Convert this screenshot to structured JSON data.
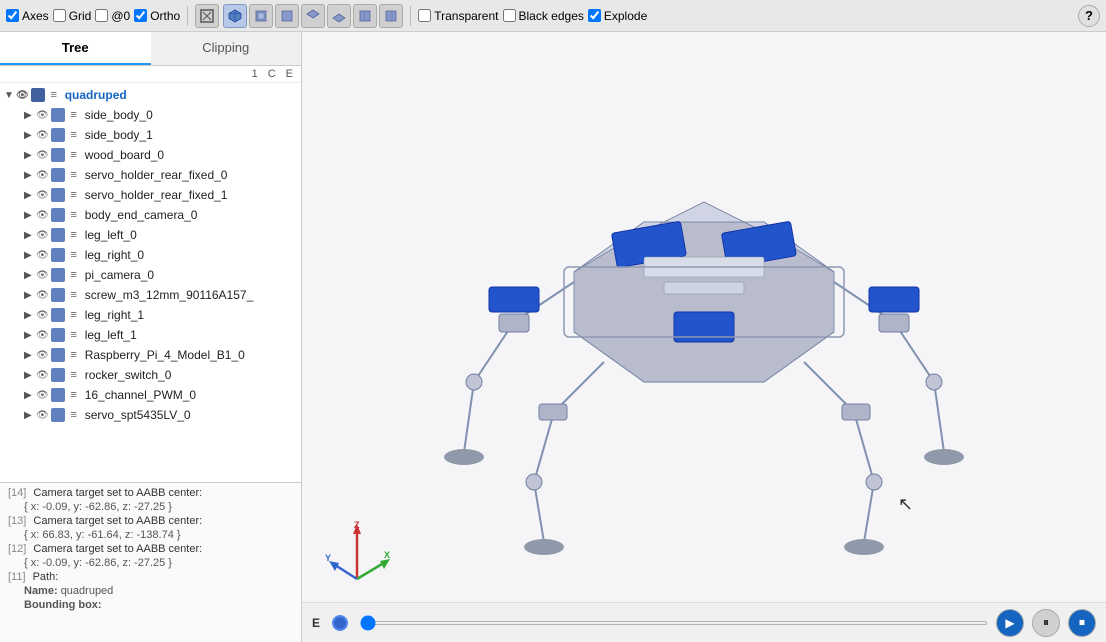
{
  "toolbar": {
    "axes_label": "Axes",
    "grid_label": "Grid",
    "at0_label": "@0",
    "ortho_label": "Ortho",
    "transparent_label": "Transparent",
    "black_edges_label": "Black edges",
    "explode_label": "Explode",
    "axes_checked": true,
    "grid_checked": false,
    "at0_checked": false,
    "ortho_checked": true,
    "transparent_checked": false,
    "black_edges_checked": false,
    "explode_checked": true,
    "help_icon": "?"
  },
  "view_buttons": [
    {
      "id": "fit",
      "label": "⊡",
      "active": false,
      "title": "Fit"
    },
    {
      "id": "iso",
      "label": "◈",
      "active": true,
      "title": "Isometric"
    },
    {
      "id": "front",
      "label": "▣",
      "active": false,
      "title": "Front"
    },
    {
      "id": "back",
      "label": "▣",
      "active": false,
      "title": "Back"
    },
    {
      "id": "top",
      "label": "▣",
      "active": false,
      "title": "Top"
    },
    {
      "id": "bottom",
      "label": "▣",
      "active": false,
      "title": "Bottom"
    },
    {
      "id": "left",
      "label": "▣",
      "active": false,
      "title": "Left"
    },
    {
      "id": "right",
      "label": "▣",
      "active": false,
      "title": "Right"
    }
  ],
  "tabs": [
    {
      "label": "Tree",
      "active": true
    },
    {
      "label": "Clipping",
      "active": false
    }
  ],
  "tree_header": {
    "col1": "1",
    "col2": "C",
    "col3": "E"
  },
  "tree_items": [
    {
      "level": 0,
      "label": "quadruped",
      "is_root": true,
      "has_arrow": true,
      "expanded": true
    },
    {
      "level": 1,
      "label": "side_body_0",
      "is_root": false,
      "has_arrow": true
    },
    {
      "level": 1,
      "label": "side_body_1",
      "is_root": false,
      "has_arrow": true
    },
    {
      "level": 1,
      "label": "wood_board_0",
      "is_root": false,
      "has_arrow": true
    },
    {
      "level": 1,
      "label": "servo_holder_rear_fixed_0",
      "is_root": false,
      "has_arrow": true
    },
    {
      "level": 1,
      "label": "servo_holder_rear_fixed_1",
      "is_root": false,
      "has_arrow": true
    },
    {
      "level": 1,
      "label": "body_end_camera_0",
      "is_root": false,
      "has_arrow": true
    },
    {
      "level": 1,
      "label": "leg_left_0",
      "is_root": false,
      "has_arrow": true
    },
    {
      "level": 1,
      "label": "leg_right_0",
      "is_root": false,
      "has_arrow": true
    },
    {
      "level": 1,
      "label": "pi_camera_0",
      "is_root": false,
      "has_arrow": true
    },
    {
      "level": 1,
      "label": "screw_m3_12mm_90116A157_",
      "is_root": false,
      "has_arrow": true
    },
    {
      "level": 1,
      "label": "leg_right_1",
      "is_root": false,
      "has_arrow": true
    },
    {
      "level": 1,
      "label": "leg_left_1",
      "is_root": false,
      "has_arrow": true
    },
    {
      "level": 1,
      "label": "Raspberry_Pi_4_Model_B1_0",
      "is_root": false,
      "has_arrow": true
    },
    {
      "level": 1,
      "label": "rocker_switch_0",
      "is_root": false,
      "has_arrow": true
    },
    {
      "level": 1,
      "label": "16_channel_PWM_0",
      "is_root": false,
      "has_arrow": true
    },
    {
      "level": 1,
      "label": "servo_spt5435LV_0",
      "is_root": false,
      "has_arrow": true
    }
  ],
  "console": {
    "entries": [
      {
        "num": "[14]",
        "main": "Camera target set to AABB center:",
        "sub": "{ x: -0.09, y: -62.86, z: -27.25 }"
      },
      {
        "num": "[13]",
        "main": "Camera target set to AABB center:",
        "sub": "{ x: 66.83, y: -61.64, z: -138.74 }"
      },
      {
        "num": "[12]",
        "main": "Camera target set to AABB center:",
        "sub": "{ x: -0.09, y: -62.86, z: -27.25 }"
      },
      {
        "num": "[11]",
        "main": "Path:",
        "sub": null
      },
      {
        "num": null,
        "main": null,
        "sub": null,
        "path_name": "Name:  quadruped"
      },
      {
        "num": null,
        "main": null,
        "sub": null,
        "path_bbox": "Bounding box:"
      }
    ]
  },
  "playback": {
    "label": "E",
    "play_icon": "▶",
    "pause_icon": "⏸",
    "stop_icon": "⏹"
  }
}
